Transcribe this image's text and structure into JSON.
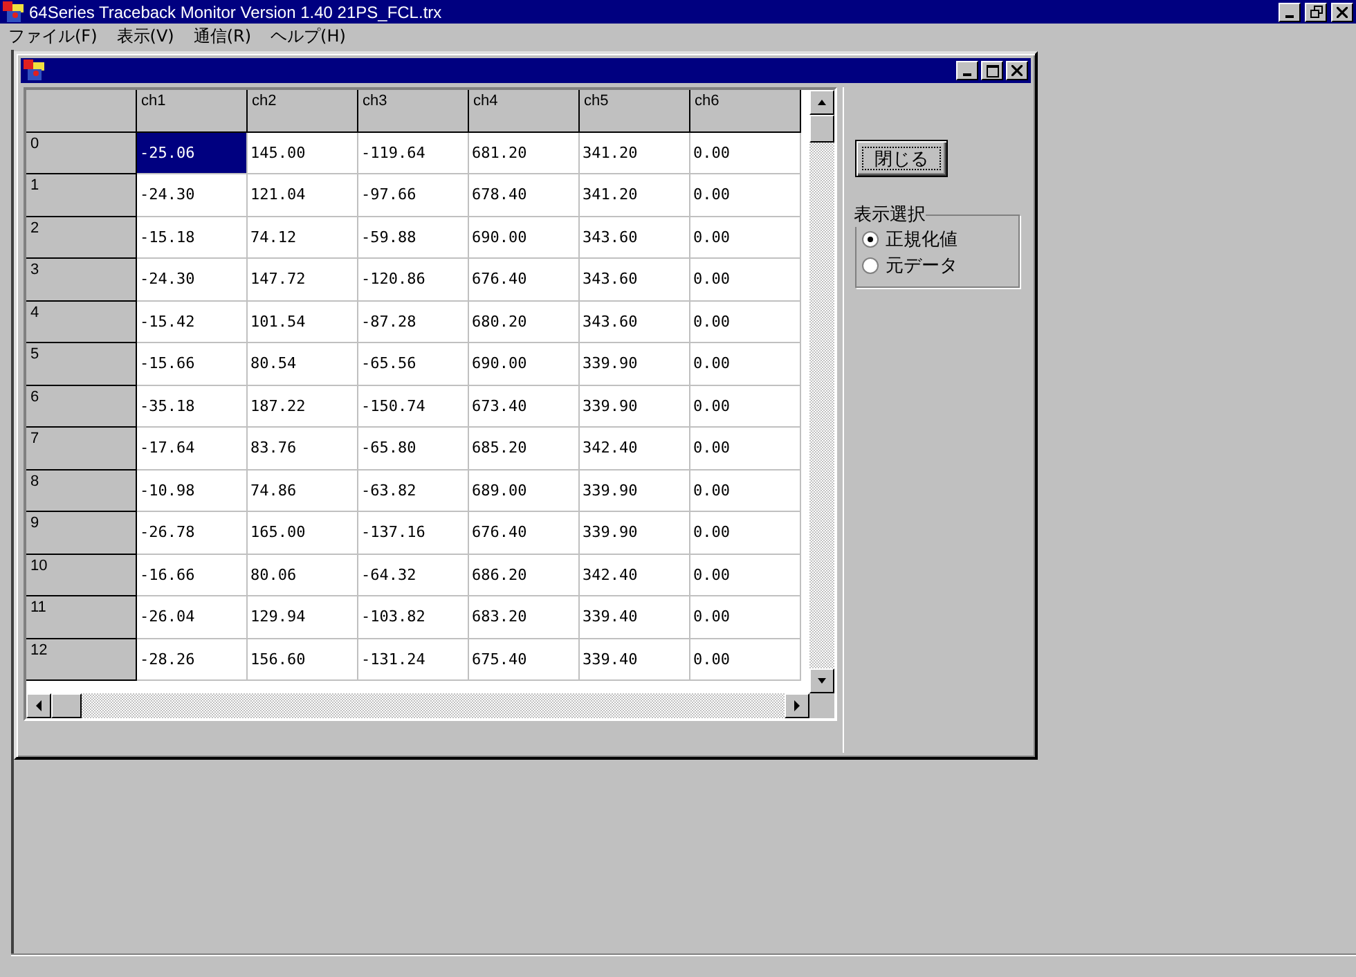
{
  "window": {
    "title": "64Series Traceback Monitor Version 1.40   21PS_FCL.trx"
  },
  "menu": [
    "ファイル(F)",
    "表示(V)",
    "通信(R)",
    "ヘルプ(H)"
  ],
  "table": {
    "columns": [
      "ch1",
      "ch2",
      "ch3",
      "ch4",
      "ch5",
      "ch6"
    ],
    "rows": [
      {
        "header": "0",
        "cells": [
          {
            "text": "-25.06",
            "selected": true
          },
          {
            "text": "145.00",
            "selected": false
          },
          {
            "text": "-119.64",
            "selected": false
          },
          {
            "text": "681.20",
            "selected": false
          },
          {
            "text": "341.20",
            "selected": false
          },
          {
            "text": "0.00",
            "selected": false
          }
        ]
      },
      {
        "header": "1",
        "cells": [
          {
            "text": "-24.30",
            "selected": false
          },
          {
            "text": "121.04",
            "selected": false
          },
          {
            "text": "-97.66",
            "selected": false
          },
          {
            "text": "678.40",
            "selected": false
          },
          {
            "text": "341.20",
            "selected": false
          },
          {
            "text": "0.00",
            "selected": false
          }
        ]
      },
      {
        "header": "2",
        "cells": [
          {
            "text": "-15.18",
            "selected": false
          },
          {
            "text": "74.12",
            "selected": false
          },
          {
            "text": "-59.88",
            "selected": false
          },
          {
            "text": "690.00",
            "selected": false
          },
          {
            "text": "343.60",
            "selected": false
          },
          {
            "text": "0.00",
            "selected": false
          }
        ]
      },
      {
        "header": "3",
        "cells": [
          {
            "text": "-24.30",
            "selected": false
          },
          {
            "text": "147.72",
            "selected": false
          },
          {
            "text": "-120.86",
            "selected": false
          },
          {
            "text": "676.40",
            "selected": false
          },
          {
            "text": "343.60",
            "selected": false
          },
          {
            "text": "0.00",
            "selected": false
          }
        ]
      },
      {
        "header": "4",
        "cells": [
          {
            "text": "-15.42",
            "selected": false
          },
          {
            "text": "101.54",
            "selected": false
          },
          {
            "text": "-87.28",
            "selected": false
          },
          {
            "text": "680.20",
            "selected": false
          },
          {
            "text": "343.60",
            "selected": false
          },
          {
            "text": "0.00",
            "selected": false
          }
        ]
      },
      {
        "header": "5",
        "cells": [
          {
            "text": "-15.66",
            "selected": false
          },
          {
            "text": "80.54",
            "selected": false
          },
          {
            "text": "-65.56",
            "selected": false
          },
          {
            "text": "690.00",
            "selected": false
          },
          {
            "text": "339.90",
            "selected": false
          },
          {
            "text": "0.00",
            "selected": false
          }
        ]
      },
      {
        "header": "6",
        "cells": [
          {
            "text": "-35.18",
            "selected": false
          },
          {
            "text": "187.22",
            "selected": false
          },
          {
            "text": "-150.74",
            "selected": false
          },
          {
            "text": "673.40",
            "selected": false
          },
          {
            "text": "339.90",
            "selected": false
          },
          {
            "text": "0.00",
            "selected": false
          }
        ]
      },
      {
        "header": "7",
        "cells": [
          {
            "text": "-17.64",
            "selected": false
          },
          {
            "text": "83.76",
            "selected": false
          },
          {
            "text": "-65.80",
            "selected": false
          },
          {
            "text": "685.20",
            "selected": false
          },
          {
            "text": "342.40",
            "selected": false
          },
          {
            "text": "0.00",
            "selected": false
          }
        ]
      },
      {
        "header": "8",
        "cells": [
          {
            "text": "-10.98",
            "selected": false
          },
          {
            "text": "74.86",
            "selected": false
          },
          {
            "text": "-63.82",
            "selected": false
          },
          {
            "text": "689.00",
            "selected": false
          },
          {
            "text": "339.90",
            "selected": false
          },
          {
            "text": "0.00",
            "selected": false
          }
        ]
      },
      {
        "header": "9",
        "cells": [
          {
            "text": "-26.78",
            "selected": false
          },
          {
            "text": "165.00",
            "selected": false
          },
          {
            "text": "-137.16",
            "selected": false
          },
          {
            "text": "676.40",
            "selected": false
          },
          {
            "text": "339.90",
            "selected": false
          },
          {
            "text": "0.00",
            "selected": false
          }
        ]
      },
      {
        "header": "10",
        "cells": [
          {
            "text": "-16.66",
            "selected": false
          },
          {
            "text": "80.06",
            "selected": false
          },
          {
            "text": "-64.32",
            "selected": false
          },
          {
            "text": "686.20",
            "selected": false
          },
          {
            "text": "342.40",
            "selected": false
          },
          {
            "text": "0.00",
            "selected": false
          }
        ]
      },
      {
        "header": "11",
        "cells": [
          {
            "text": "-26.04",
            "selected": false
          },
          {
            "text": "129.94",
            "selected": false
          },
          {
            "text": "-103.82",
            "selected": false
          },
          {
            "text": "683.20",
            "selected": false
          },
          {
            "text": "339.40",
            "selected": false
          },
          {
            "text": "0.00",
            "selected": false
          }
        ]
      },
      {
        "header": "12",
        "cells": [
          {
            "text": "-28.26",
            "selected": false
          },
          {
            "text": "156.60",
            "selected": false
          },
          {
            "text": "-131.24",
            "selected": false
          },
          {
            "text": "675.40",
            "selected": false
          },
          {
            "text": "339.40",
            "selected": false
          },
          {
            "text": "0.00",
            "selected": false
          }
        ]
      }
    ]
  },
  "close_button": "閉じる",
  "display_group": {
    "title": "表示選択",
    "options": [
      {
        "label": "正規化値",
        "selected": true
      },
      {
        "label": "元データ",
        "selected": false
      }
    ]
  }
}
